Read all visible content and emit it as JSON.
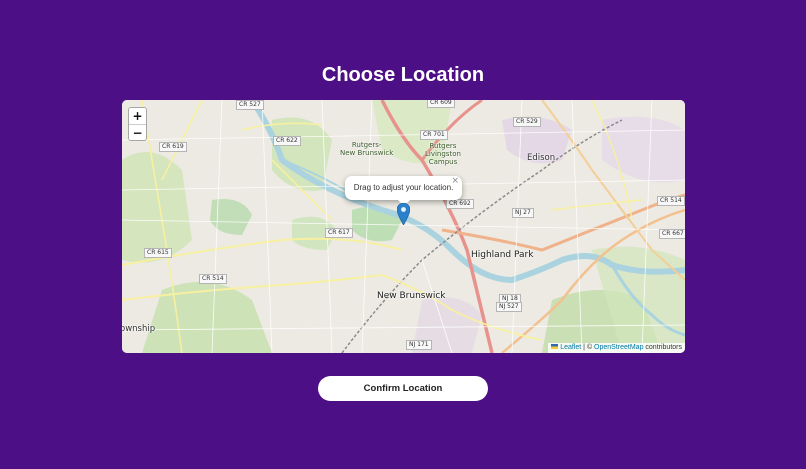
{
  "page": {
    "title": "Choose Location",
    "confirm_label": "Confirm Location",
    "background_color": "#4d0f85"
  },
  "map": {
    "zoom_in_label": "+",
    "zoom_out_label": "−",
    "popup_text": "Drag to adjust your location.",
    "popup_close": "×",
    "marker_color": "#2a81cb",
    "attribution": {
      "leaflet": "Leaflet",
      "separator": " | © ",
      "osm": "OpenStreetMap",
      "suffix": " contributors"
    },
    "places": {
      "new_brunswick": "New Brunswick",
      "highland_park": "Highland Park",
      "edison": "Edison",
      "piscataway": "ownship",
      "rutgers_nb": "Rutgers-\nNew Brunswick",
      "rutgers_livingston": "Rutgers\nLivingston\nCampus"
    },
    "shields": {
      "cr527_top": "CR 527",
      "cr622": "CR 622",
      "cr619": "CR 619",
      "cr701": "CR 701",
      "cr529": "CR 529",
      "cr609": "CR 609",
      "cr692": "CR 692",
      "nj27": "NJ 27",
      "cr514_right": "CR 514",
      "cr667": "CR 667",
      "cr617": "CR 617",
      "cr615": "CR 615",
      "cr514_left": "CR 514",
      "nj18": "NJ 18",
      "nj527": "NJ 527",
      "nj171": "NJ 171"
    }
  }
}
